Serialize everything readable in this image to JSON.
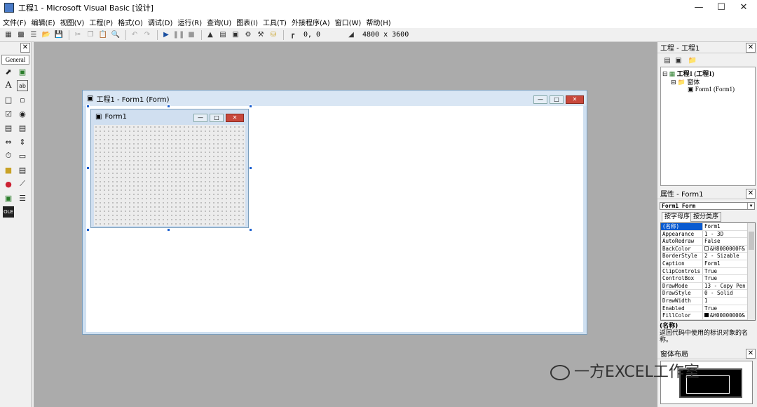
{
  "window": {
    "title": "工程1 - Microsoft Visual Basic [设计]"
  },
  "menu": [
    "文件(F)",
    "编辑(E)",
    "视图(V)",
    "工程(P)",
    "格式(O)",
    "调试(D)",
    "运行(R)",
    "查询(U)",
    "图表(I)",
    "工具(T)",
    "外接程序(A)",
    "窗口(W)",
    "帮助(H)"
  ],
  "toolbar": {
    "position": "0, 0",
    "size": "4800 x 3600"
  },
  "toolbox": {
    "tab": "General"
  },
  "project_window": {
    "title": "工程1 - Form1 (Form)"
  },
  "form1": {
    "title": "Form1"
  },
  "project_panel": {
    "title": "工程 - 工程1",
    "tree": {
      "root": "工程1 (工程1)",
      "folder": "窗体",
      "item": "Form1 (Form1)"
    }
  },
  "properties_panel": {
    "title": "属性 - Form1",
    "object": "Form1 Form",
    "tabs": [
      "按字母序",
      "按分类序"
    ],
    "rows": [
      {
        "name": "(名称)",
        "value": "Form1"
      },
      {
        "name": "Appearance",
        "value": "1 - 3D"
      },
      {
        "name": "AutoRedraw",
        "value": "False"
      },
      {
        "name": "BackColor",
        "value": "&H8000000F&"
      },
      {
        "name": "BorderStyle",
        "value": "2 - Sizable"
      },
      {
        "name": "Caption",
        "value": "Form1"
      },
      {
        "name": "ClipControls",
        "value": "True"
      },
      {
        "name": "ControlBox",
        "value": "True"
      },
      {
        "name": "DrawMode",
        "value": "13 - Copy Pen"
      },
      {
        "name": "DrawStyle",
        "value": "0 - Solid"
      },
      {
        "name": "DrawWidth",
        "value": "1"
      },
      {
        "name": "Enabled",
        "value": "True"
      },
      {
        "name": "FillColor",
        "value": "&H00000000&"
      }
    ],
    "desc_title": "(名称)",
    "desc_text": "返回代码中使用的标识对象的名称。"
  },
  "layout_panel": {
    "title": "窗体布局"
  },
  "watermark": "一方EXCEL工作室",
  "colors": {
    "workspace": "#ababab",
    "selection": "#0a5bd0",
    "close": "#c8483c"
  }
}
